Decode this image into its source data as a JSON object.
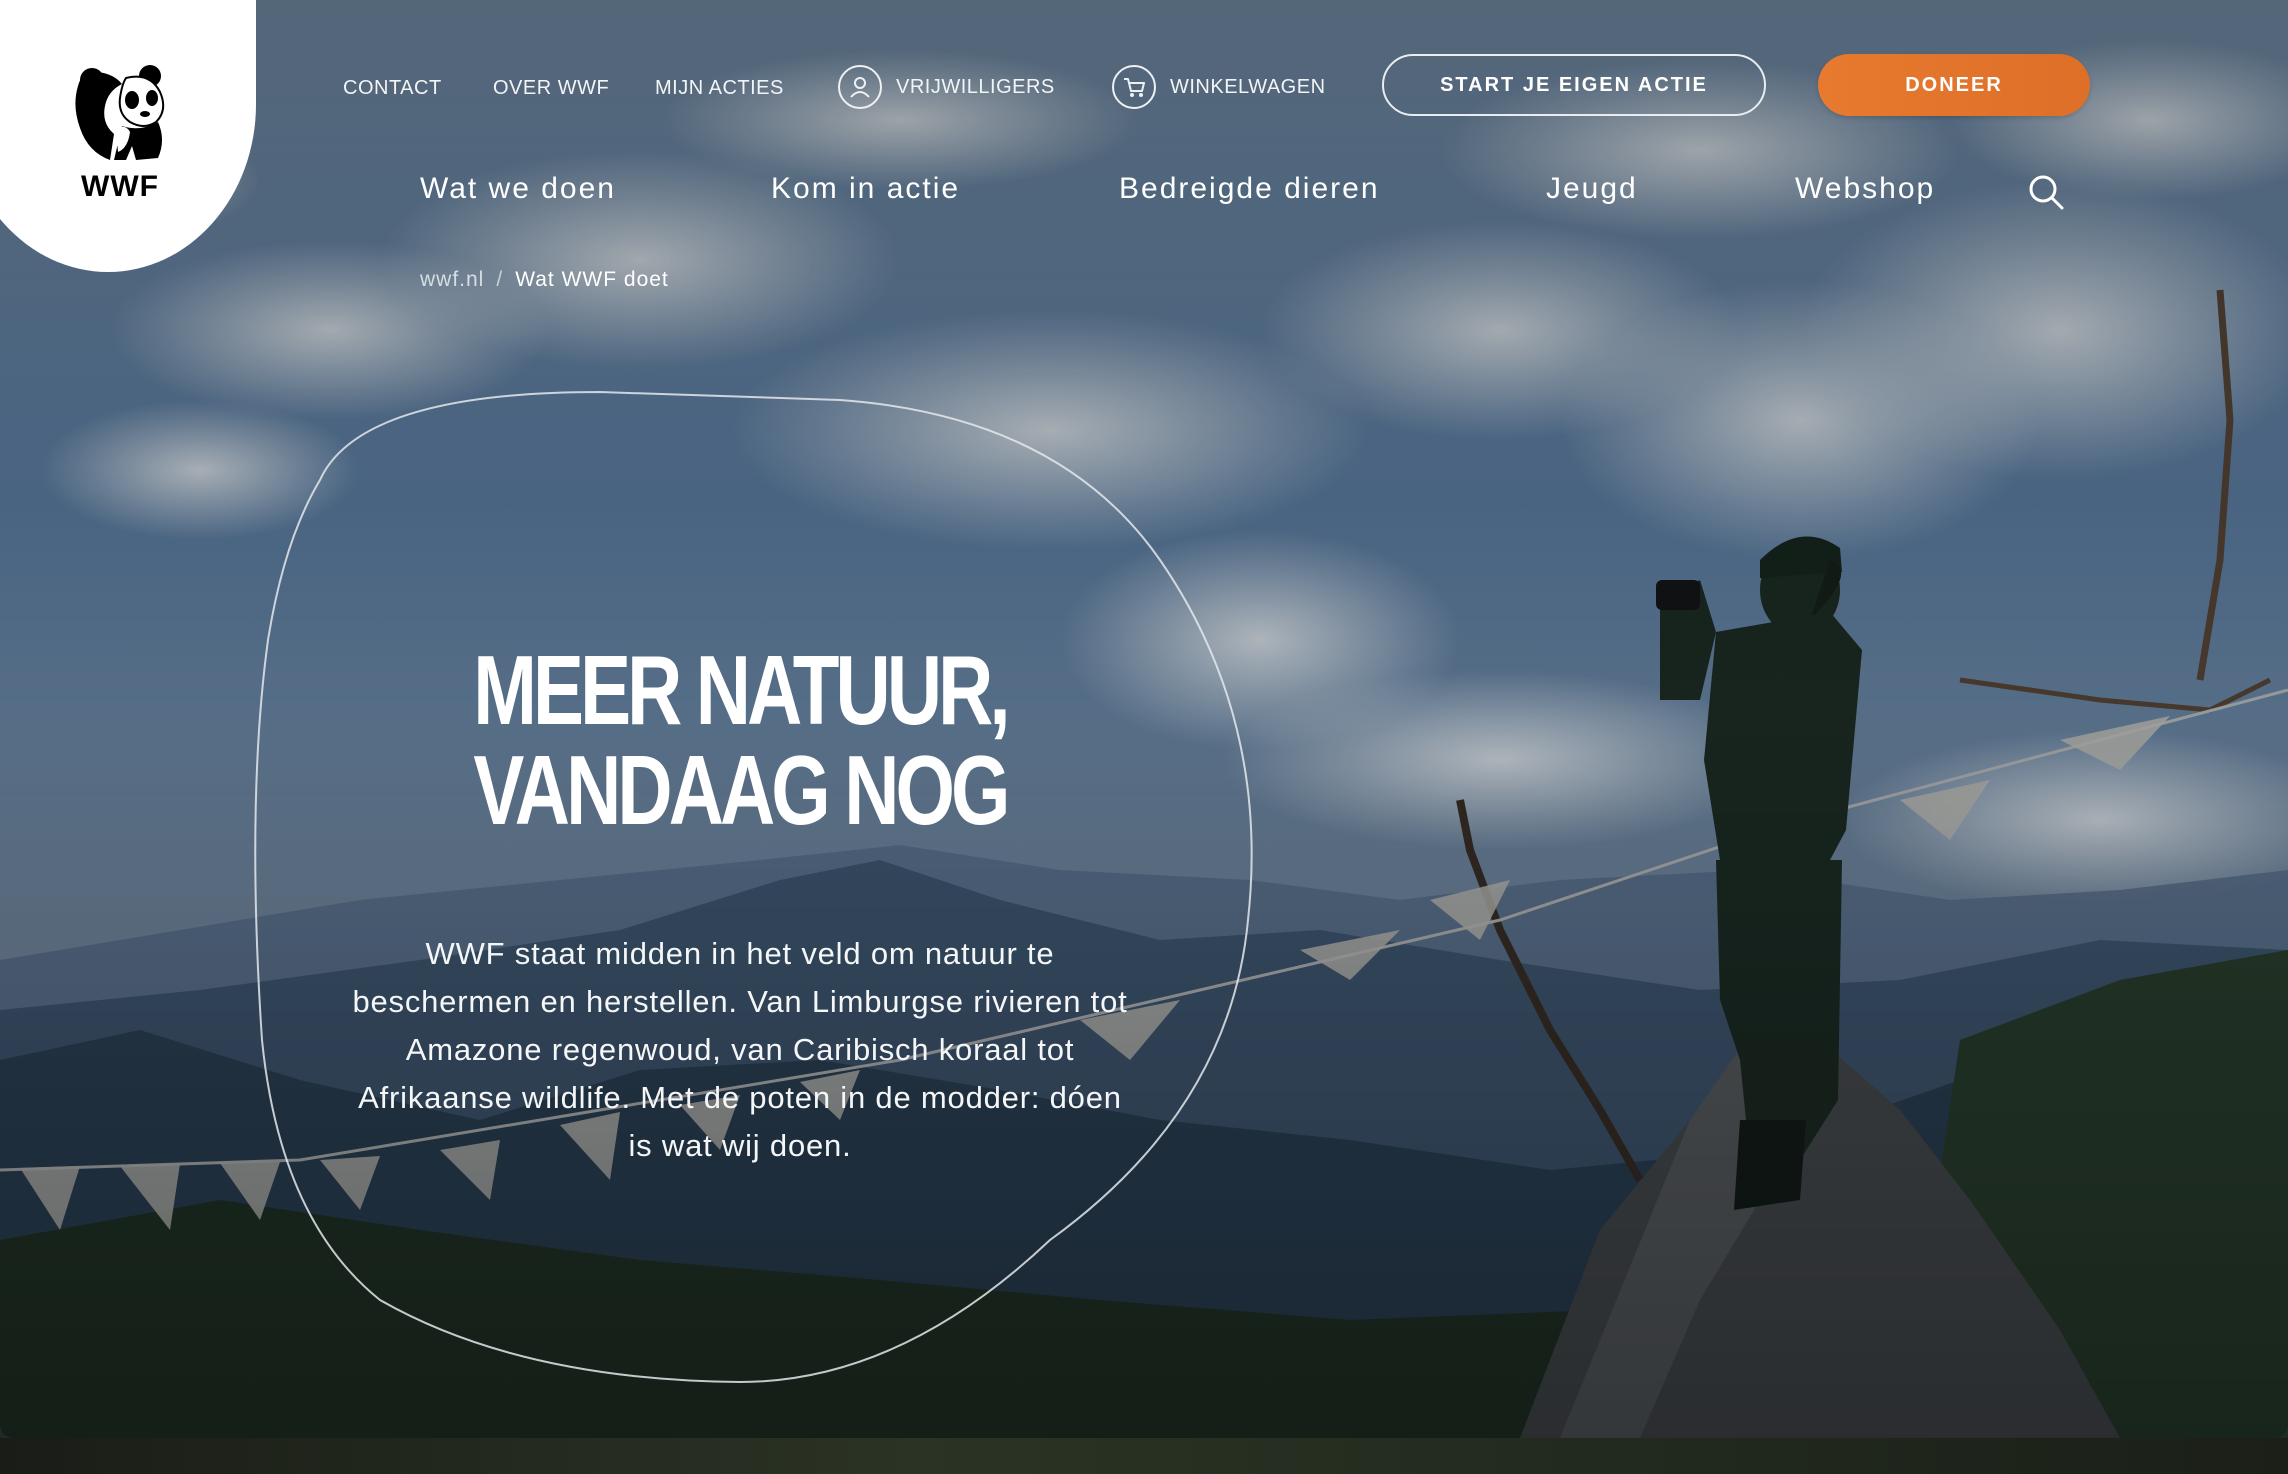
{
  "brand": {
    "logo_text": "WWF"
  },
  "utility_nav": {
    "contact": "CONTACT",
    "about": "OVER WWF",
    "my_actions": "MIJN ACTIES",
    "volunteers": "VRIJWILLIGERS",
    "cart": "WINKELWAGEN"
  },
  "buttons": {
    "start_action": "START JE EIGEN ACTIE",
    "donate": "DONEER"
  },
  "main_nav": [
    "Wat we doen",
    "Kom in actie",
    "Bedreigde dieren",
    "Jeugd",
    "Webshop"
  ],
  "breadcrumb": {
    "home": "wwf.nl",
    "separator": "/",
    "current": "Wat WWF doet"
  },
  "hero": {
    "headline_line1": "MEER NATUUR,",
    "headline_line2": "VANDAAG NOG",
    "body": "WWF staat midden in het veld om natuur te beschermen en herstellen. Van Limburgse rivieren tot Amazone regenwoud, van Caribisch koraal tot Afrikaanse wildlife. Met de poten in de modder: dóen is wat wij doen."
  },
  "colors": {
    "donate": "#E2732B",
    "text": "#FFFFFF"
  },
  "icons": [
    "panda-logo",
    "user-icon",
    "cart-icon",
    "search-icon"
  ]
}
